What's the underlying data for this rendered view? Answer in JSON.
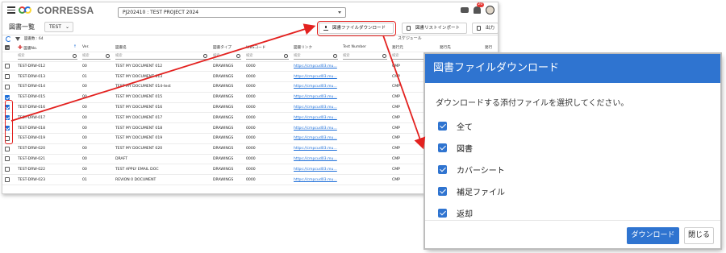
{
  "app": {
    "logo_text": "CORRESSA",
    "project": "PJ202410 : TEST PROJECT 2024",
    "notification_count": "20",
    "page_title": "図書一覧",
    "filter_value": "TEST",
    "toolbar": {
      "download_label": "図書ファイルダウンロード",
      "import_label": "図書リストインポート",
      "export_label": "出力"
    },
    "count_text": "図書数 : 64",
    "schedule_label": "スケジュール",
    "columns": [
      "図書No.",
      "Ver.",
      "図書名",
      "図書タイプ",
      "WBSコード",
      "図書リンク",
      "Test Number",
      "発行元",
      "発行先",
      "発行"
    ],
    "search_placeholder": "検索",
    "rows": [
      {
        "no": "TEST-DRW-012",
        "ver": "00",
        "name": "TEST MY DOCUMENT 012",
        "type": "DRAWINGS",
        "wbs": "0000",
        "link": "https://cmpcud03.mu...",
        "issuer": "CMP",
        "checked": false
      },
      {
        "no": "TEST-DRW-013",
        "ver": "01",
        "name": "TEST MY DOCUMENT 013",
        "type": "DRAWINGS",
        "wbs": "0000",
        "link": "https://cmpcud03.mu...",
        "issuer": "CMP",
        "checked": false
      },
      {
        "no": "TEST-DRW-014",
        "ver": "00",
        "name": "TEST MY DOCUMENT 014-test",
        "type": "DRAWINGS",
        "wbs": "0000",
        "link": "https://cmpcud03.mu...",
        "issuer": "CMP",
        "checked": false
      },
      {
        "no": "TEST-DRW-015",
        "ver": "00",
        "name": "TEST MY DOCUMENT 015",
        "type": "DRAWINGS",
        "wbs": "0000",
        "link": "https://cmpcud03.mu...",
        "issuer": "CMP",
        "checked": true
      },
      {
        "no": "TEST-DRW-016",
        "ver": "00",
        "name": "TEST MY DOCUMENT 016",
        "type": "DRAWINGS",
        "wbs": "0000",
        "link": "https://cmpcud03.mu...",
        "issuer": "CMP",
        "checked": true
      },
      {
        "no": "TEST-DRW-017",
        "ver": "00",
        "name": "TEST MY DOCUMENT 017",
        "type": "DRAWINGS",
        "wbs": "0000",
        "link": "https://cmpcud03.mu...",
        "issuer": "CMP",
        "checked": true
      },
      {
        "no": "TEST-DRW-018",
        "ver": "00",
        "name": "TEST MY DOCUMENT 018",
        "type": "DRAWINGS",
        "wbs": "0000",
        "link": "https://cmpcud03.mu...",
        "issuer": "CMP",
        "checked": true
      },
      {
        "no": "TEST-DRW-019",
        "ver": "00",
        "name": "TEST MY DOCUMENT 019",
        "type": "DRAWINGS",
        "wbs": "0000",
        "link": "https://cmpcud03.mu...",
        "issuer": "CMP",
        "checked": false
      },
      {
        "no": "TEST-DRW-020",
        "ver": "00",
        "name": "TEST MY DOCUMENT 020",
        "type": "DRAWINGS",
        "wbs": "0000",
        "link": "https://cmpcud03.mu...",
        "issuer": "CMP",
        "checked": false
      },
      {
        "no": "TEST-DRW-021",
        "ver": "00",
        "name": "DRAFT",
        "type": "DRAWINGS",
        "wbs": "0000",
        "link": "https://cmpcud03.mu...",
        "issuer": "CMP",
        "checked": false
      },
      {
        "no": "TEST-DRW-022",
        "ver": "00",
        "name": "TEST APPLY EMAIL DOC",
        "type": "DRAWINGS",
        "wbs": "0000",
        "link": "https://cmpcud03.mu...",
        "issuer": "CMP",
        "checked": false
      },
      {
        "no": "TEST-DRW-023",
        "ver": "01",
        "name": "REVION 0 DOCUMENT",
        "type": "DRAWINGS",
        "wbs": "0000",
        "link": "https://cmpcud03.mu...",
        "issuer": "CMP",
        "checked": false
      }
    ]
  },
  "dialog": {
    "title": "図書ファイルダウンロード",
    "message": "ダウンロードする添付ファイルを選択してください。",
    "options": [
      {
        "label": "全て",
        "checked": true
      },
      {
        "label": "図書",
        "checked": true
      },
      {
        "label": "カバーシート",
        "checked": true
      },
      {
        "label": "補足ファイル",
        "checked": true
      },
      {
        "label": "返却",
        "checked": true
      }
    ],
    "download_button": "ダウンロード",
    "close_button": "閉じる"
  },
  "colors": {
    "accent": "#2f74d0",
    "highlight": "#e3211f",
    "link": "#1e6fd9"
  }
}
